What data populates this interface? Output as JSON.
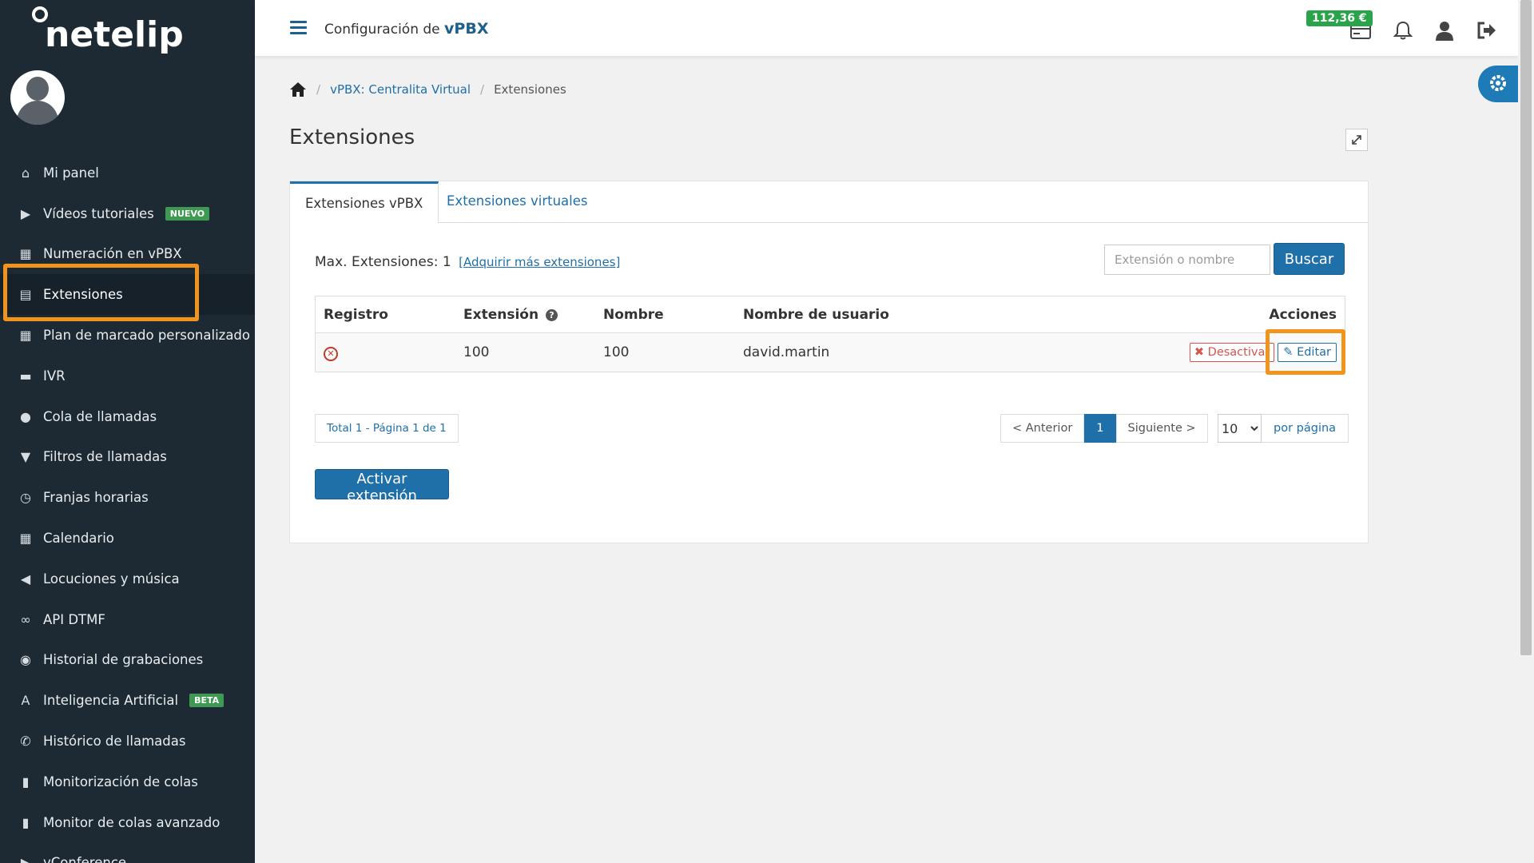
{
  "brand": {
    "logo_text": "netelip"
  },
  "topbar": {
    "title_prefix": "Configuración de",
    "title_bold": "vPBX",
    "balance": "112,36 €"
  },
  "sidebar": {
    "items": [
      {
        "label": "Mi panel",
        "icon": "home-icon"
      },
      {
        "label": "Vídeos tutoriales",
        "icon": "video-icon",
        "badge": "NUEVO"
      },
      {
        "label": "Numeración en vPBX",
        "icon": "grid-icon"
      },
      {
        "label": "Extensiones",
        "icon": "list-icon",
        "active": true
      },
      {
        "label": "Plan de marcado personalizado",
        "icon": "grid-icon"
      },
      {
        "label": "IVR",
        "icon": "chat-icon"
      },
      {
        "label": "Cola de llamadas",
        "icon": "user-icon"
      },
      {
        "label": "Filtros de llamadas",
        "icon": "filter-icon"
      },
      {
        "label": "Franjas horarias",
        "icon": "clock-icon"
      },
      {
        "label": "Calendario",
        "icon": "calendar-icon"
      },
      {
        "label": "Locuciones y música",
        "icon": "volume-icon"
      },
      {
        "label": "API DTMF",
        "icon": "link-icon"
      },
      {
        "label": "Historial de grabaciones",
        "icon": "record-icon"
      },
      {
        "label": "Inteligencia Artificial",
        "icon": "font-icon",
        "badge": "BETA"
      },
      {
        "label": "Histórico de llamadas",
        "icon": "phone-icon"
      },
      {
        "label": "Monitorización de colas",
        "icon": "bar-chart-icon"
      },
      {
        "label": "Monitor de colas avanzado",
        "icon": "bar-chart-icon"
      },
      {
        "label": "vConference",
        "icon": "video-icon"
      }
    ]
  },
  "breadcrumb": {
    "home_icon": "home-icon",
    "link": "vPBX: Centralita Virtual",
    "current": "Extensiones"
  },
  "page": {
    "title": "Extensiones"
  },
  "tabs": {
    "active": "Extensiones vPBX",
    "other": "Extensiones virtuales"
  },
  "main": {
    "max_label": "Max. Extensiones: 1",
    "acquire_link": "[Adquirir más extensiones]",
    "search_placeholder": "Extensión o nombre",
    "search_button": "Buscar",
    "table": {
      "headers": {
        "registro": "Registro",
        "extension": "Extensión",
        "nombre": "Nombre",
        "usuario": "Nombre de usuario",
        "acciones": "Acciones"
      },
      "rows": [
        {
          "status": "unregistered",
          "extension": "100",
          "nombre": "100",
          "usuario": "david.martin"
        }
      ],
      "deactivate_label": "Desactivar",
      "edit_label": "Editar"
    },
    "total": "Total 1 - Página 1 de 1",
    "pager": {
      "prev": "< Anterior",
      "current": "1",
      "next": "Siguiente >"
    },
    "per_page": {
      "value": "10",
      "options": [
        "10"
      ],
      "label": "por página"
    },
    "activate_button": "Activar extensión"
  },
  "colors": {
    "sidebar_bg": "#1d2a33",
    "accent": "#1f6fa8",
    "highlight": "#f0941e",
    "balance_bg": "#2aa44a"
  }
}
